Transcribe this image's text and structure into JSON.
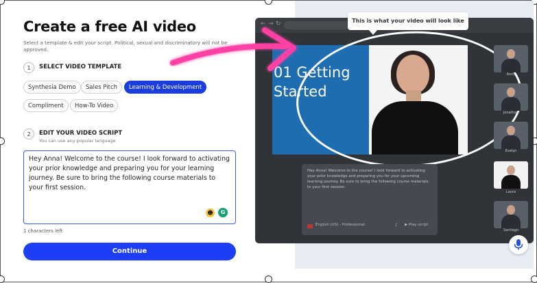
{
  "form": {
    "title": "Create a free AI video",
    "subtitle": "Select a template & edit your script. Political, sexual and discriminatory will not be approved.",
    "step1": {
      "num": "1",
      "label": "SELECT VIDEO TEMPLATE"
    },
    "templates": [
      "Synthesia Demo",
      "Sales Pitch",
      "Learning & Development",
      "Compliment",
      "How-To Video"
    ],
    "selected_template": "Learning & Development",
    "step2": {
      "num": "2",
      "label": "EDIT YOUR VIDEO SCRIPT",
      "sub": "You can use any popular language"
    },
    "script": "Hey Anna! Welcome to the course! I look forward to activating your prior knowledge and preparing you for your learning journey. Be sure to bring the following course materials to your first session.",
    "chars_left": "1 characters left",
    "continue_label": "Continue"
  },
  "preview": {
    "tooltip": "This is what your video will look like",
    "slide_title": "01 Getting Started",
    "script_text": "Hey Anna! Welcome to the course! I look forward to activating your prior knowledge and preparing you for your upcoming learning journey. Be sure to bring the following course materials to your first session.",
    "language": "English (US) - Professional",
    "play_label": "Play script",
    "avatars": [
      {
        "name": "Anna",
        "selected": false
      },
      {
        "name": "Jonathan",
        "selected": false
      },
      {
        "name": "Evelyn",
        "selected": false
      },
      {
        "name": "Laura",
        "selected": true
      },
      {
        "name": "Santiago",
        "selected": false
      }
    ]
  },
  "colors": {
    "accent_blue": "#1d3ef5",
    "chip_active": "#1b3dde",
    "slide_blue": "#1d6db0",
    "arrow_pink": "#ff3fa4",
    "grammarly_green": "#15a073"
  },
  "icons": {
    "emoji": "emoji-icon",
    "grammarly": "grammarly-icon",
    "mic": "microphone-icon"
  }
}
